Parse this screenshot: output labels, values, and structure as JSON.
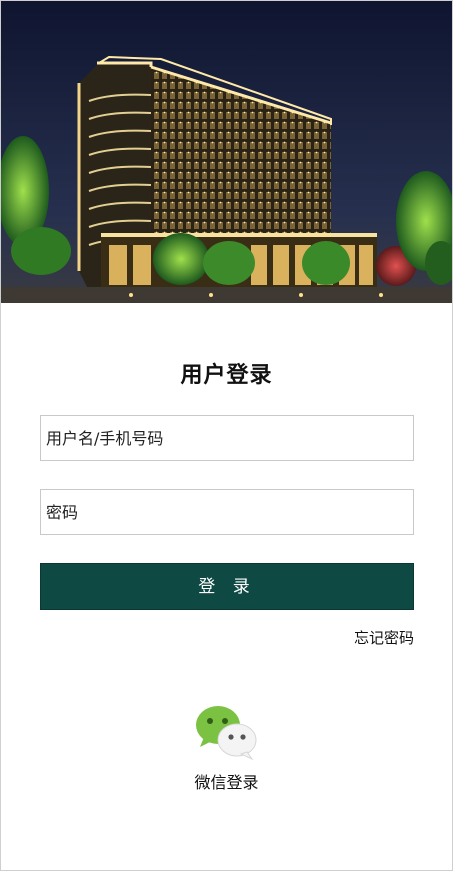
{
  "banner": {
    "icon": "hotel-building-photo"
  },
  "login": {
    "title": "用户登录",
    "username_placeholder": "用户名/手机号码",
    "password_placeholder": "密码",
    "submit_label": "登 录",
    "forgot_label": "忘记密码"
  },
  "wechat": {
    "icon": "wechat-icon",
    "label": "微信登录",
    "colors": {
      "green": "#7bc142",
      "white": "#f4f4f4"
    }
  },
  "colors": {
    "button": "#0f4944",
    "night_sky": "#16203a",
    "building_light": "#f3d58a"
  }
}
